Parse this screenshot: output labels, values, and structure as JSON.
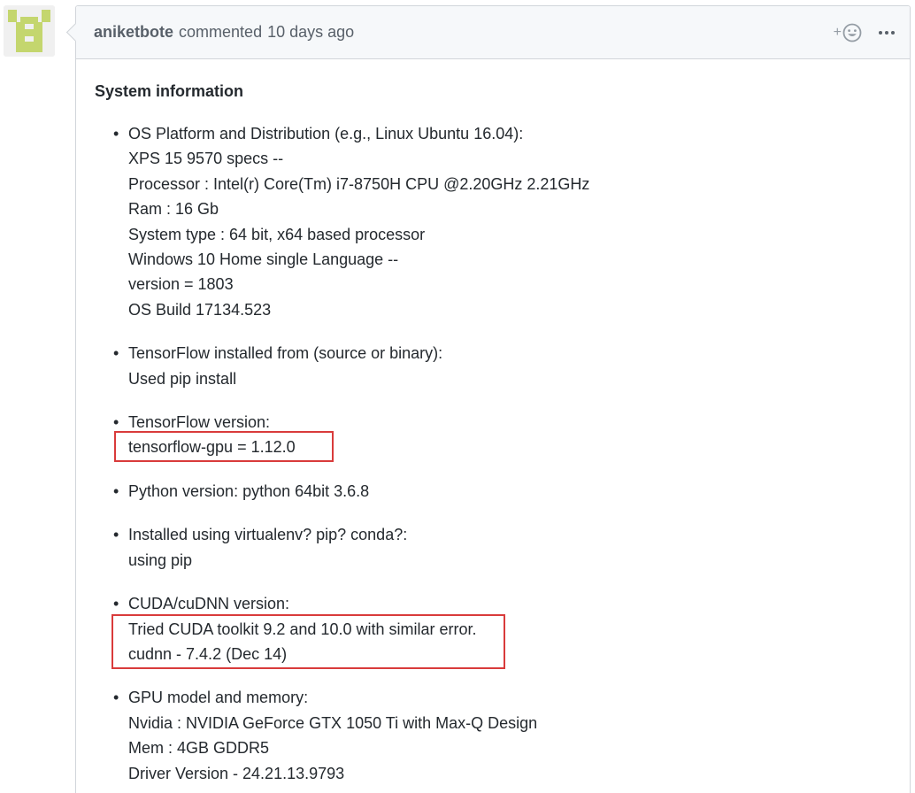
{
  "comment": {
    "author": "aniketbote",
    "action": "commented",
    "timestamp": "10 days ago",
    "reaction_plus": "+",
    "reaction_icon": "smiley-icon",
    "more_icon": "kebab-horizontal-icon"
  },
  "body": {
    "section_title": "System information",
    "items": [
      {
        "label": "OS Platform and Distribution (e.g., Linux Ubuntu 16.04):",
        "lines": [
          "XPS 15 9570 specs --",
          "Processor : Intel(r) Core(Tm) i7-8750H CPU @2.20GHz 2.21GHz",
          "Ram : 16 Gb",
          "System type : 64 bit, x64 based processor",
          "Windows 10 Home single Language --",
          "version = 1803",
          "OS Build 17134.523"
        ]
      },
      {
        "label": "TensorFlow installed from (source or binary):",
        "lines": [
          "Used pip install"
        ]
      },
      {
        "label": "TensorFlow version:",
        "lines": [
          "tensorflow-gpu = 1.12.0"
        ]
      },
      {
        "label": "Python version: python 64bit 3.6.8",
        "lines": []
      },
      {
        "label": "Installed using virtualenv? pip? conda?:",
        "lines": [
          "using pip"
        ]
      },
      {
        "label": "CUDA/cuDNN version:",
        "lines": [
          "Tried CUDA toolkit 9.2 and 10.0 with similar error.",
          "cudnn - 7.4.2 (Dec 14)"
        ]
      },
      {
        "label": "GPU model and memory:",
        "lines": [
          "Nvidia : NVIDIA GeForce GTX 1050 Ti with Max-Q Design",
          "Mem : 4GB GDDR5",
          "Driver Version - 24.21.13.9793"
        ]
      }
    ]
  },
  "colors": {
    "avatar_fg": "#c4d66e",
    "highlight_border": "#d93b3b",
    "header_bg": "#f6f8fa",
    "border": "#d1d5da"
  }
}
